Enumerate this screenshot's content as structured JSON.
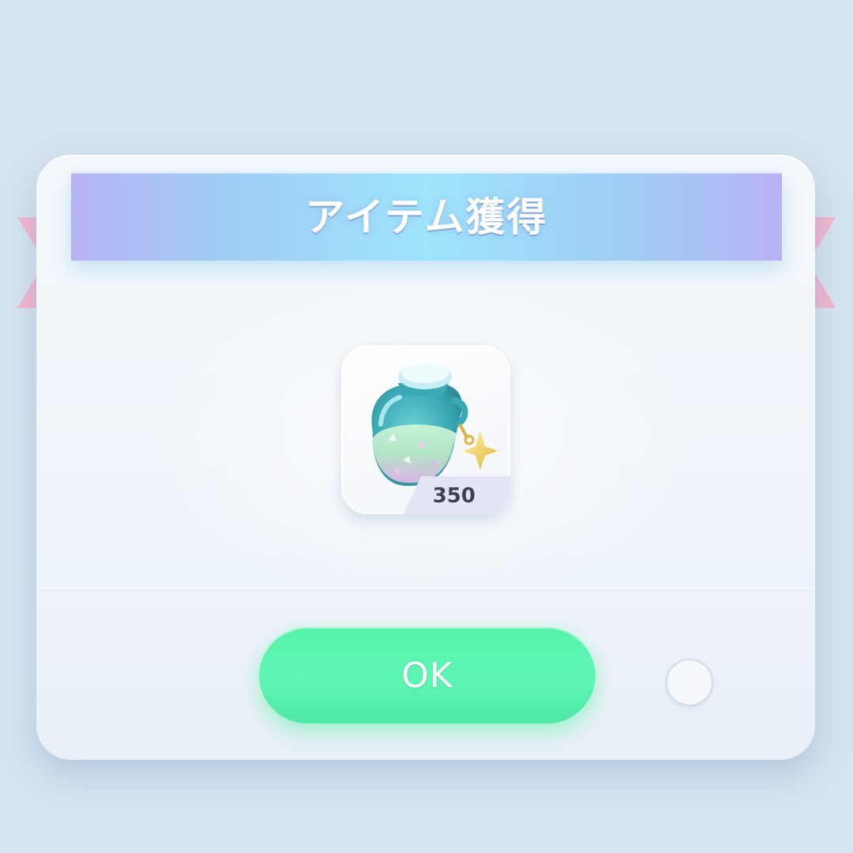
{
  "dialog": {
    "title": "アイテム獲得",
    "ok_label": "OK"
  },
  "item": {
    "icon": "potion-bottle-icon",
    "count": "350"
  },
  "colors": {
    "background": "#d6e3f0",
    "ribbon_center": "#9fe4fb",
    "ribbon_edge": "#b7b3f4",
    "ribbon_tail": "#f2b4cc",
    "ok_button": "#5ef5b6"
  }
}
